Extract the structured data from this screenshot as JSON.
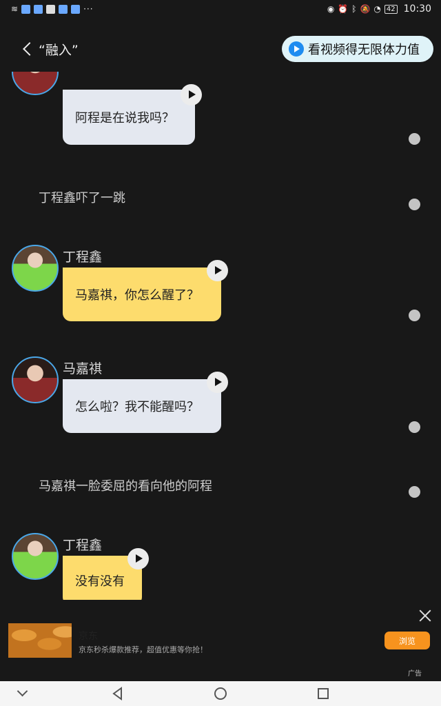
{
  "status_bar": {
    "dots": "···",
    "battery": "42",
    "time": "10:30"
  },
  "header": {
    "title": "“融入”",
    "promo_label": "看视频得无限体力值"
  },
  "messages": [
    {
      "type": "dialogue",
      "speaker": "",
      "text": "阿程是在说我吗？",
      "bubble": "grey"
    },
    {
      "type": "narration",
      "text": "丁程鑫吓了一跳"
    },
    {
      "type": "dialogue",
      "speaker": "丁程鑫",
      "text": "马嘉祺，你怎么醒了？",
      "bubble": "yellow"
    },
    {
      "type": "dialogue",
      "speaker": "马嘉祺",
      "text": "怎么啦？我不能醒吗？",
      "bubble": "grey"
    },
    {
      "type": "narration",
      "text": "马嘉祺一脸委屈的看向他的阿程"
    },
    {
      "type": "dialogue",
      "speaker": "丁程鑫",
      "text": "没有没有",
      "bubble": "yellow"
    }
  ],
  "ad": {
    "title": "京东",
    "description": "京东秒杀爆款推荐，超值优惠等你抢！",
    "button_label": "浏览",
    "mark": "广告"
  },
  "colors": {
    "background": "#181818",
    "bubble_grey": "#e4e8f0",
    "bubble_yellow": "#fddc6d",
    "promo_bg": "#dff3f8",
    "accent_blue": "#1e8cf0",
    "ad_button": "#f7931e"
  },
  "icons": [
    "wifi-icon",
    "notification-icon",
    "eye-icon",
    "alarm-icon",
    "bluetooth-icon",
    "mute-icon",
    "battery-icon",
    "play-icon",
    "back-chevron-icon",
    "close-icon"
  ]
}
